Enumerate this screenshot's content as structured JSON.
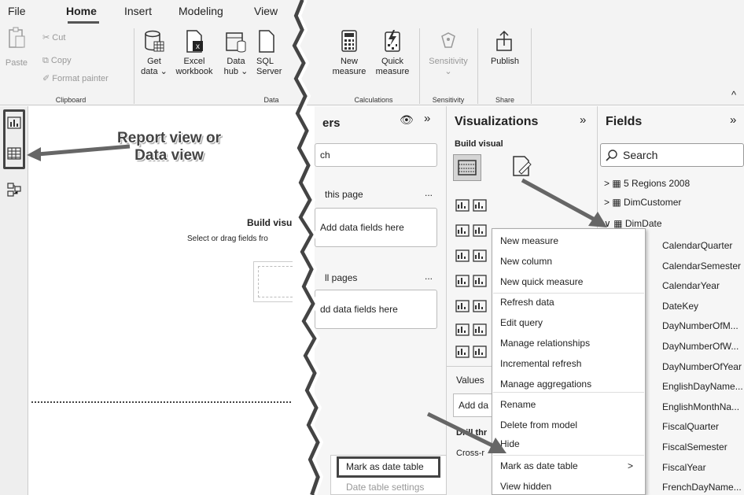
{
  "menu": {
    "file": "File",
    "home": "Home",
    "insert": "Insert",
    "modeling": "Modeling",
    "view": "View"
  },
  "ribbon": {
    "paste": "Paste",
    "cut": "Cut",
    "copy": "Copy",
    "format_painter": "Format painter",
    "clipboard_group": "Clipboard",
    "get_data_1": "Get",
    "get_data_2": "data ⌄",
    "excel_1": "Excel",
    "excel_2": "workbook",
    "hub_1": "Data",
    "hub_2": "hub ⌄",
    "sql_1": "SQL",
    "sql_2": "Server",
    "data_group": "Data",
    "new_measure_1": "New",
    "new_measure_2": "measure",
    "quick_measure_1": "Quick",
    "quick_measure_2": "measure",
    "calc_group": "Calculations",
    "sensitivity": "Sensitivity",
    "sensitivity_chev": "⌄",
    "sensitivity_group": "Sensitivity",
    "publish": "Publish",
    "share_group": "Share",
    "collapse": "^"
  },
  "callouts": {
    "report_view": "Report view or",
    "data_view": "Data view"
  },
  "canvas": {
    "build_visual": "Build visu",
    "select_drag": "Select or drag fields fro"
  },
  "filters": {
    "title": "ers",
    "search": "ch",
    "this_page": "this page",
    "this_page_more": "...",
    "add_here_1": "Add data fields here",
    "all_pages": "ll pages",
    "all_pages_more": "...",
    "add_here_2": "dd data fields here"
  },
  "viz": {
    "title": "Visualizations",
    "build_visual": "Build visual",
    "values": "Values",
    "add_da": "Add da",
    "drill": "Drill thr",
    "cross": "Cross-r"
  },
  "fields": {
    "title": "Fields",
    "search_placeholder": "Search",
    "tables": [
      {
        "name": "5 Regions 2008",
        "arrow": ">"
      },
      {
        "name": "DimCustomer",
        "arrow": ">"
      },
      {
        "name": "DimDate",
        "arrow": "∨"
      }
    ],
    "columns": [
      "CalendarQuarter",
      "CalendarSemester",
      "CalendarYear",
      "DateKey",
      "DayNumberOfM...",
      "DayNumberOfW...",
      "DayNumberOfYear",
      "EnglishDayName...",
      "EnglishMonthNa...",
      "FiscalQuarter",
      "FiscalSemester",
      "FiscalYear",
      "FrenchDayName..."
    ]
  },
  "context_menu": {
    "items": [
      "New measure",
      "New column",
      "New quick measure",
      "Refresh data",
      "Edit query",
      "Manage relationships",
      "Incremental refresh",
      "Manage aggregations",
      "Rename",
      "Delete from model",
      "Hide",
      "Mark as date table",
      "View hidden"
    ],
    "submenu_arrow": ">"
  },
  "mini_menu": {
    "mark": "Mark as date table",
    "settings": "Date table settings"
  }
}
